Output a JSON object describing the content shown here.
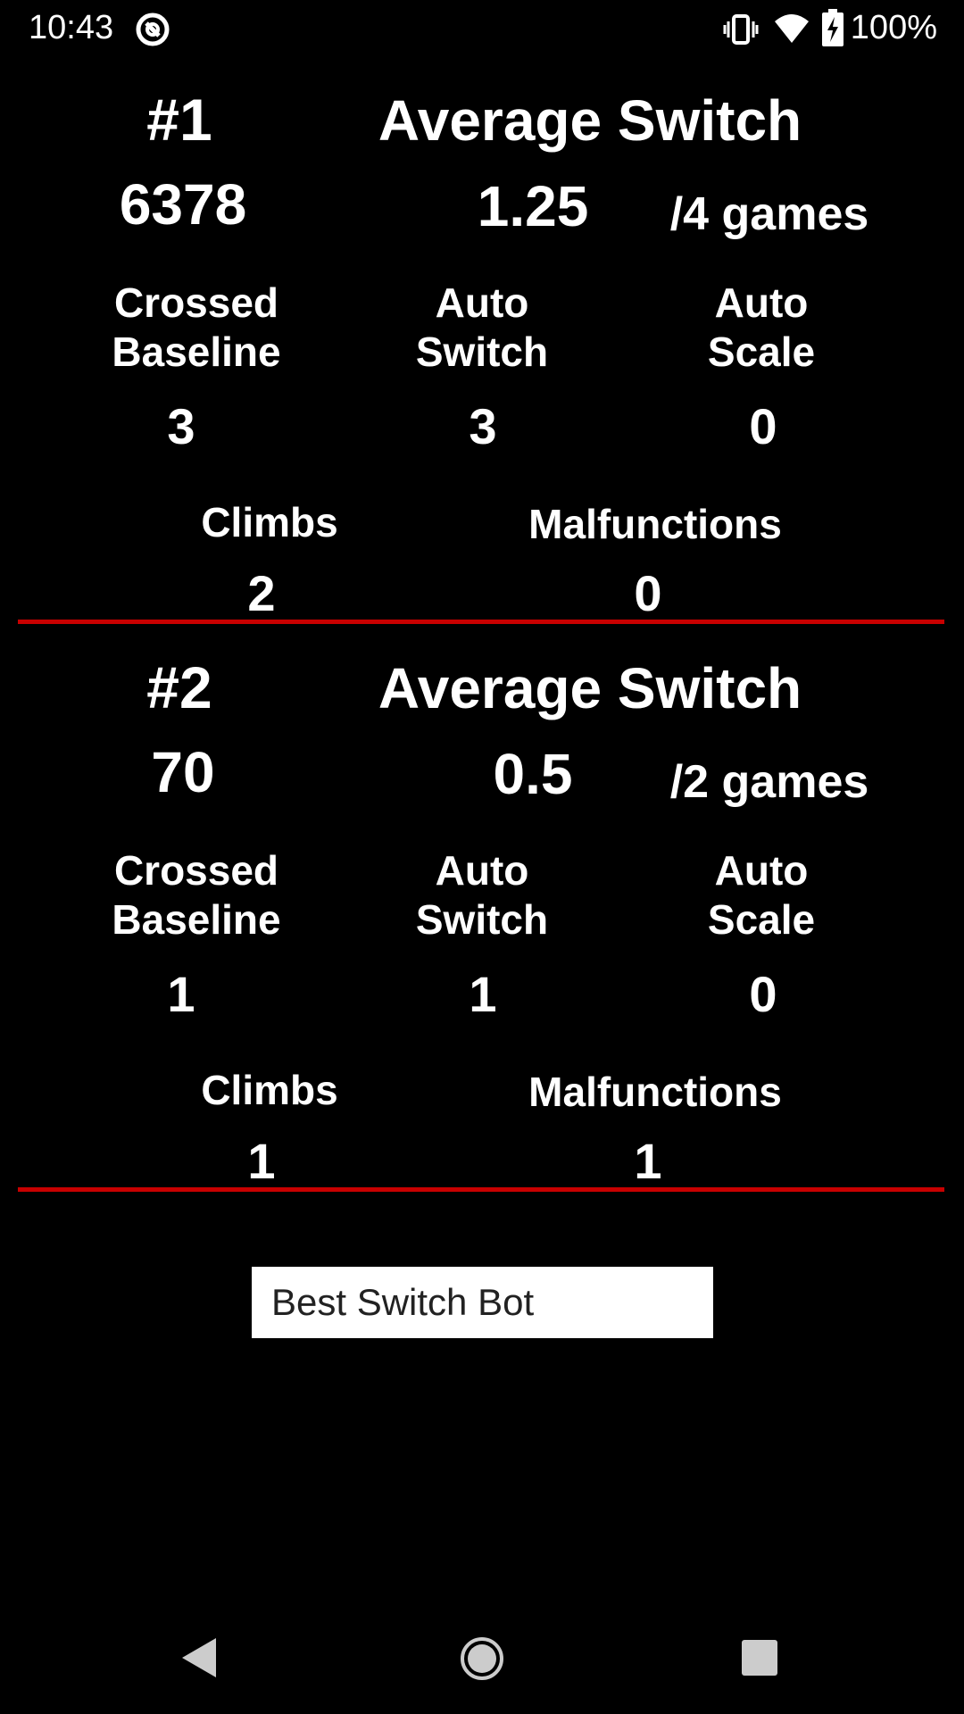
{
  "status_bar": {
    "time": "10:43",
    "battery": "100%",
    "icons": [
      "sync-icon",
      "vibrate-icon",
      "wifi-icon",
      "battery-charging-icon"
    ]
  },
  "teams": [
    {
      "rank": "#1",
      "number": "6378",
      "avg_header": "Average Switch",
      "avg_value": "1.25",
      "games": "/4 games",
      "stats": {
        "crossed_baseline": {
          "label_1": "Crossed",
          "label_2": "Baseline",
          "value": "3"
        },
        "auto_switch": {
          "label_1": "Auto",
          "label_2": "Switch",
          "value": "3"
        },
        "auto_scale": {
          "label_1": "Auto",
          "label_2": "Scale",
          "value": "0"
        },
        "climbs": {
          "label": "Climbs",
          "value": "2"
        },
        "malfunctions": {
          "label": "Malfunctions",
          "value": "0"
        }
      }
    },
    {
      "rank": "#2",
      "number": "70",
      "avg_header": "Average Switch",
      "avg_value": "0.5",
      "games": "/2 games",
      "stats": {
        "crossed_baseline": {
          "label_1": "Crossed",
          "label_2": "Baseline",
          "value": "1"
        },
        "auto_switch": {
          "label_1": "Auto",
          "label_2": "Switch",
          "value": "1"
        },
        "auto_scale": {
          "label_1": "Auto",
          "label_2": "Scale",
          "value": "0"
        },
        "climbs": {
          "label": "Climbs",
          "value": "1"
        },
        "malfunctions": {
          "label": "Malfunctions",
          "value": "1"
        }
      }
    }
  ],
  "selector": {
    "value": "Best Switch Bot"
  },
  "nav_bar": {
    "icons": [
      "back-icon",
      "home-icon",
      "recents-icon"
    ]
  },
  "colors": {
    "background": "#000000",
    "divider": "#c80000",
    "text": "#ffffff"
  }
}
